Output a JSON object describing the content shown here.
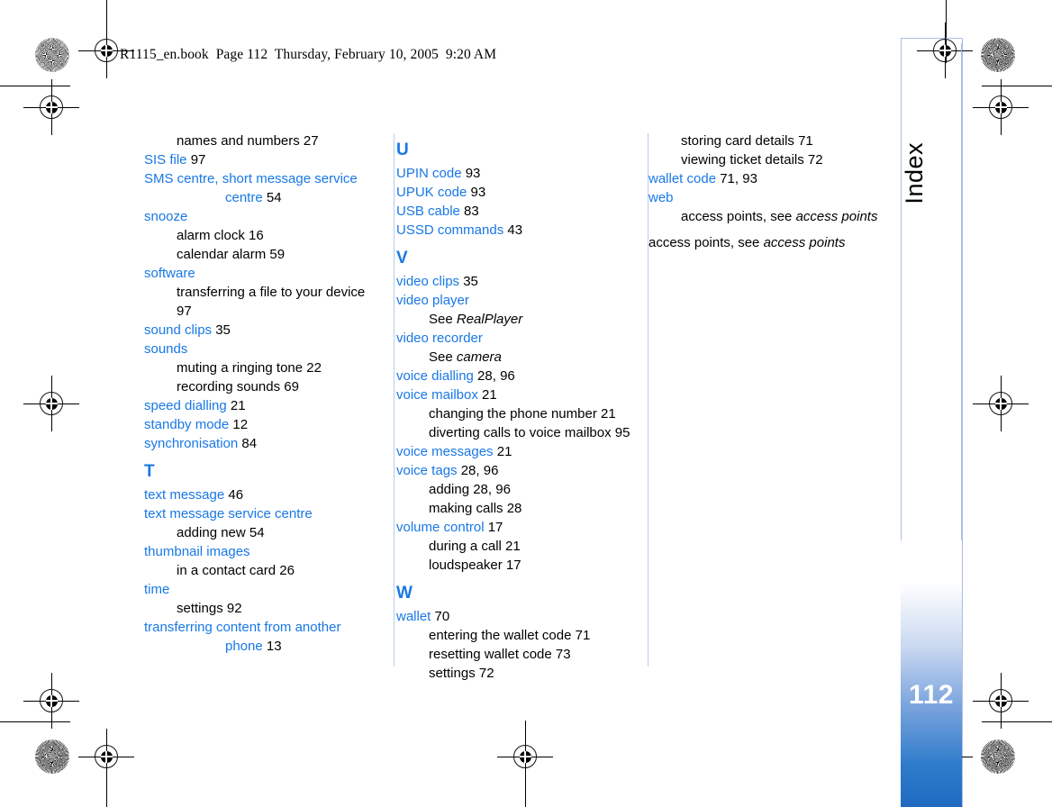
{
  "document": {
    "running_header": "R1115_en.book  Page 112  Thursday, February 10, 2005  9:20 AM",
    "side_tab_label": "Index",
    "page_number": "112"
  },
  "colors": {
    "headword_blue": "#1878e6",
    "section_letter_blue": "#1878e6",
    "rule_blue": "#b9cbe8",
    "tab_edge_blue": "#aebde4",
    "gradient_bottom": "#1f6ac0",
    "body_black": "#000000"
  },
  "columns": [
    {
      "id": "column-1",
      "entries": [
        {
          "level": 1,
          "term": "names and numbers",
          "pages": "27",
          "color": "black"
        },
        {
          "level": 0,
          "term": "SIS file",
          "pages": "97",
          "color": "blue"
        },
        {
          "level": 0,
          "term": "SMS centre, short message service centre",
          "pages": "54",
          "color": "blue",
          "wrap": true
        },
        {
          "level": 0,
          "term": "snooze",
          "pages": "",
          "color": "blue"
        },
        {
          "level": 1,
          "term": "alarm clock",
          "pages": "16",
          "color": "black"
        },
        {
          "level": 1,
          "term": "calendar alarm",
          "pages": "59",
          "color": "black"
        },
        {
          "level": 0,
          "term": "software",
          "pages": "",
          "color": "blue"
        },
        {
          "level": 1,
          "term": "transferring a file to your device",
          "pages": "97",
          "color": "black"
        },
        {
          "level": 0,
          "term": "sound clips",
          "pages": "35",
          "color": "blue"
        },
        {
          "level": 0,
          "term": "sounds",
          "pages": "",
          "color": "blue"
        },
        {
          "level": 1,
          "term": "muting a ringing tone",
          "pages": "22",
          "color": "black"
        },
        {
          "level": 1,
          "term": "recording sounds",
          "pages": "69",
          "color": "black"
        },
        {
          "level": 0,
          "term": "speed dialling",
          "pages": "21",
          "color": "blue"
        },
        {
          "level": 0,
          "term": "standby mode",
          "pages": "12",
          "color": "blue"
        },
        {
          "level": 0,
          "term": "synchronisation",
          "pages": "84",
          "color": "blue"
        },
        {
          "level": "letter",
          "term": "T"
        },
        {
          "level": 0,
          "term": "text message",
          "pages": "46",
          "color": "blue"
        },
        {
          "level": 0,
          "term": "text message service centre",
          "pages": "",
          "color": "blue"
        },
        {
          "level": 1,
          "term": "adding new",
          "pages": "54",
          "color": "black"
        },
        {
          "level": 0,
          "term": "thumbnail images",
          "pages": "",
          "color": "blue"
        },
        {
          "level": 1,
          "term": "in a contact card",
          "pages": "26",
          "color": "black"
        },
        {
          "level": 0,
          "term": "time",
          "pages": "",
          "color": "blue"
        },
        {
          "level": 1,
          "term": "settings",
          "pages": "92",
          "color": "black"
        },
        {
          "level": 0,
          "term": "transferring content from another phone",
          "pages": "13",
          "color": "blue",
          "wrap": true
        }
      ]
    },
    {
      "id": "column-2",
      "entries": [
        {
          "level": "letter",
          "term": "U"
        },
        {
          "level": 0,
          "term": "UPIN code",
          "pages": "93",
          "color": "blue"
        },
        {
          "level": 0,
          "term": "UPUK code",
          "pages": "93",
          "color": "blue"
        },
        {
          "level": 0,
          "term": "USB cable",
          "pages": "83",
          "color": "blue"
        },
        {
          "level": 0,
          "term": "USSD commands",
          "pages": "43",
          "color": "blue"
        },
        {
          "level": "letter",
          "term": "V"
        },
        {
          "level": 0,
          "term": "video clips",
          "pages": "35",
          "color": "blue"
        },
        {
          "level": 0,
          "term": "video player",
          "pages": "",
          "color": "blue"
        },
        {
          "level": 1,
          "term": "See ",
          "italic": "RealPlayer",
          "pages": "",
          "color": "black"
        },
        {
          "level": 0,
          "term": "video recorder",
          "pages": "",
          "color": "blue"
        },
        {
          "level": 1,
          "term": "See ",
          "italic": "camera",
          "pages": "",
          "color": "black"
        },
        {
          "level": 0,
          "term": "voice dialling",
          "pages": "28, 96",
          "color": "blue"
        },
        {
          "level": 0,
          "term": "voice mailbox",
          "pages": "21",
          "color": "blue"
        },
        {
          "level": 1,
          "term": "changing the phone number",
          "pages": "21",
          "color": "black"
        },
        {
          "level": 1,
          "term": "diverting calls to voice mailbox",
          "pages": "95",
          "color": "black"
        },
        {
          "level": 0,
          "term": "voice messages",
          "pages": "21",
          "color": "blue"
        },
        {
          "level": 0,
          "term": "voice tags",
          "pages": "28, 96",
          "color": "blue"
        },
        {
          "level": 1,
          "term": "adding",
          "pages": "28, 96",
          "color": "black"
        },
        {
          "level": 1,
          "term": "making calls",
          "pages": "28",
          "color": "black"
        },
        {
          "level": 0,
          "term": "volume control",
          "pages": "17",
          "color": "blue"
        },
        {
          "level": 1,
          "term": "during a call",
          "pages": "21",
          "color": "black"
        },
        {
          "level": 1,
          "term": "loudspeaker",
          "pages": "17",
          "color": "black"
        },
        {
          "level": "letter",
          "term": "W"
        },
        {
          "level": 0,
          "term": "wallet",
          "pages": "70",
          "color": "blue"
        },
        {
          "level": 1,
          "term": "entering the wallet code",
          "pages": "71",
          "color": "black"
        },
        {
          "level": 1,
          "term": "resetting wallet code",
          "pages": "73",
          "color": "black"
        },
        {
          "level": 1,
          "term": "settings",
          "pages": "72",
          "color": "black"
        }
      ]
    },
    {
      "id": "column-3",
      "entries": [
        {
          "level": 1,
          "term": "storing card details",
          "pages": "71",
          "color": "black"
        },
        {
          "level": 1,
          "term": "viewing ticket details",
          "pages": "72",
          "color": "black"
        },
        {
          "level": 0,
          "term": "wallet code",
          "pages": "71, 93",
          "color": "blue"
        },
        {
          "level": 0,
          "term": "web",
          "pages": "",
          "color": "blue"
        },
        {
          "level": 1,
          "term": "access points, see ",
          "italic": "access points",
          "pages": "",
          "color": "black"
        },
        {
          "level": "gap"
        },
        {
          "level": 0,
          "term": "access points, see ",
          "italic": "access points",
          "pages": "",
          "color": "black"
        }
      ]
    }
  ]
}
